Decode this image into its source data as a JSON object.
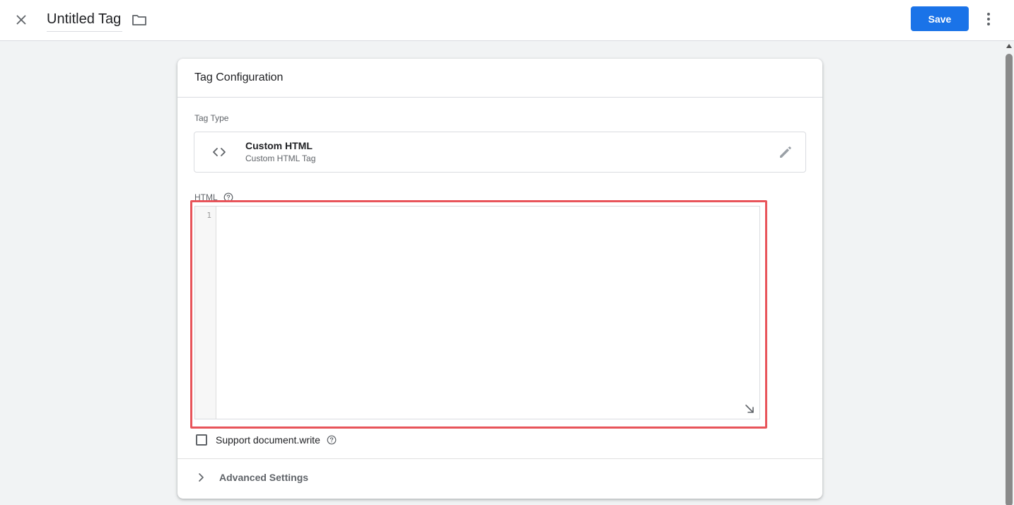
{
  "header": {
    "tag_name": "Untitled Tag",
    "save_label": "Save"
  },
  "card": {
    "title": "Tag Configuration",
    "tag_type_label": "Tag Type",
    "tag_type": {
      "name": "Custom HTML",
      "description": "Custom HTML Tag"
    },
    "html_label": "HTML",
    "editor": {
      "line_numbers": [
        "1"
      ],
      "content": ""
    },
    "support_document_write": {
      "label": "Support document.write",
      "checked": false
    },
    "advanced_settings_label": "Advanced Settings"
  },
  "icons": {
    "close": "close-icon",
    "folder": "folder-icon",
    "more": "more-vert-icon",
    "code": "code-icon",
    "edit": "pencil-icon",
    "help": "help-circle-icon",
    "resize": "resize-arrow-icon",
    "chevron": "chevron-right-icon"
  },
  "colors": {
    "primary": "#1a73e8",
    "highlight": "#e8545a",
    "background": "#f1f3f4"
  }
}
